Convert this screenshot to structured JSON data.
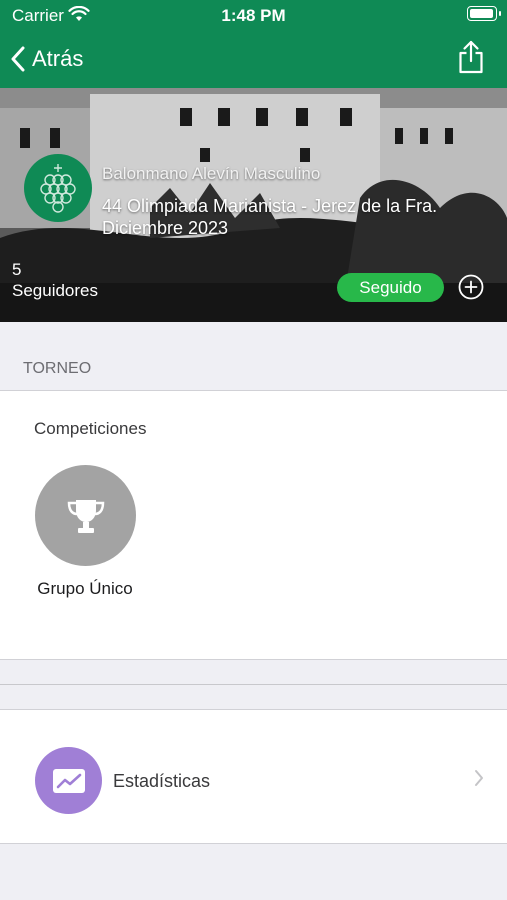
{
  "status_bar": {
    "carrier": "Carrier",
    "time": "1:48 PM"
  },
  "nav": {
    "back_label": "Atrás"
  },
  "hero": {
    "title": "Balonmano Alevín Masculino",
    "subtitle_line1": "44 Olimpiada Marianista - Jerez de la Fra.",
    "subtitle_line2": "Diciembre 2023",
    "followers_count": "5",
    "followers_label": "Seguidores",
    "follow_button": "Seguido"
  },
  "section": {
    "header": "TORNEO"
  },
  "competitions": {
    "title": "Competiciones",
    "items": [
      {
        "label": "Grupo Único",
        "icon": "trophy-icon"
      }
    ]
  },
  "stats": {
    "label": "Estadísticas",
    "icon": "chart-line-icon"
  },
  "colors": {
    "brand_green": "#0f8a55",
    "follow_green": "#28b84a",
    "stats_purple": "#a07fd6",
    "trophy_grey": "#a3a3a3"
  }
}
